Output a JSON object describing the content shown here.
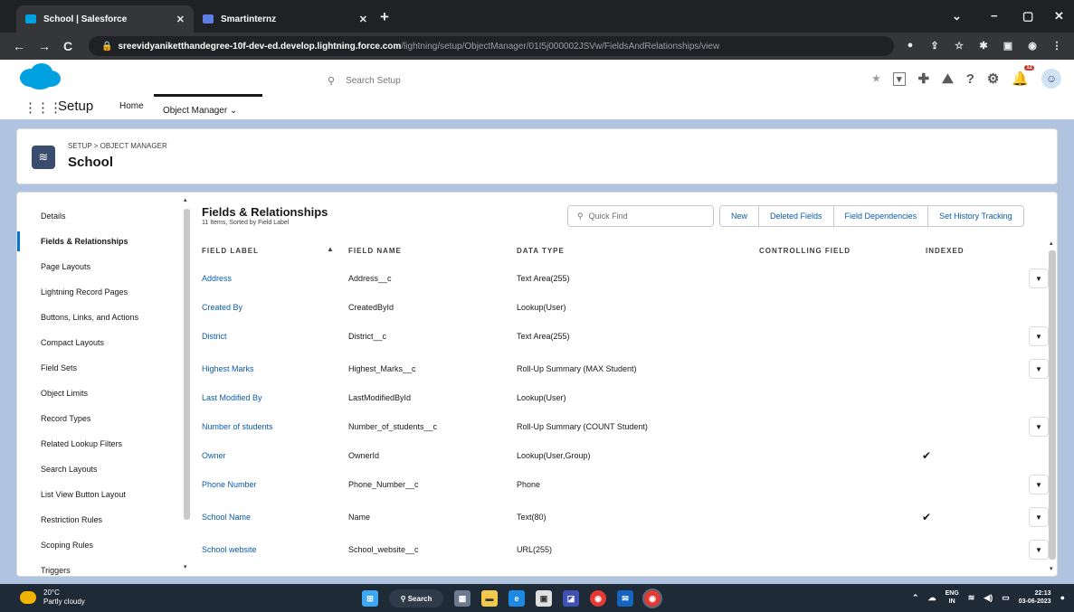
{
  "browser": {
    "tabs": [
      {
        "title": "School | Salesforce",
        "favicon_color": "#00a1e0"
      },
      {
        "title": "Smartinternz",
        "favicon_color": "#5e7ce2"
      }
    ],
    "url_host": "sreevidyaniketthandegree-10f-dev-ed.develop.lightning.force.com",
    "url_path": "/lightning/setup/ObjectManager/01I5j000002JSVw/FieldsAndRelationships/view"
  },
  "header": {
    "search_placeholder": "Search Setup",
    "app_name": "Setup",
    "nav_tabs": [
      "Home",
      "Object Manager"
    ],
    "notification_count": "12"
  },
  "object": {
    "breadcrumb": "SETUP > OBJECT MANAGER",
    "title": "School"
  },
  "sidebar": {
    "items": [
      "Details",
      "Fields & Relationships",
      "Page Layouts",
      "Lightning Record Pages",
      "Buttons, Links, and Actions",
      "Compact Layouts",
      "Field Sets",
      "Object Limits",
      "Record Types",
      "Related Lookup Filters",
      "Search Layouts",
      "List View Button Layout",
      "Restriction Rules",
      "Scoping Rules",
      "Triggers"
    ],
    "selected_index": 1
  },
  "fields": {
    "title": "Fields & Relationships",
    "subtitle": "11 Items, Sorted by Field Label",
    "quick_find_placeholder": "Quick Find",
    "buttons": [
      "New",
      "Deleted Fields",
      "Field Dependencies",
      "Set History Tracking"
    ],
    "columns": [
      "FIELD LABEL",
      "FIELD NAME",
      "DATA TYPE",
      "CONTROLLING FIELD",
      "INDEXED"
    ],
    "rows": [
      {
        "label": "Address",
        "name": "Address__c",
        "type": "Text Area(255)",
        "controlling": "",
        "indexed": false,
        "menu": true
      },
      {
        "label": "Created By",
        "name": "CreatedById",
        "type": "Lookup(User)",
        "controlling": "",
        "indexed": false,
        "menu": false
      },
      {
        "label": "District",
        "name": "District__c",
        "type": "Text Area(255)",
        "controlling": "",
        "indexed": false,
        "menu": true
      },
      {
        "label": "Highest Marks",
        "name": "Highest_Marks__c",
        "type": "Roll-Up Summary (MAX Student)",
        "controlling": "",
        "indexed": false,
        "menu": true
      },
      {
        "label": "Last Modified By",
        "name": "LastModifiedById",
        "type": "Lookup(User)",
        "controlling": "",
        "indexed": false,
        "menu": false
      },
      {
        "label": "Number of students",
        "name": "Number_of_students__c",
        "type": "Roll-Up Summary (COUNT Student)",
        "controlling": "",
        "indexed": false,
        "menu": true
      },
      {
        "label": "Owner",
        "name": "OwnerId",
        "type": "Lookup(User,Group)",
        "controlling": "",
        "indexed": true,
        "menu": false
      },
      {
        "label": "Phone Number",
        "name": "Phone_Number__c",
        "type": "Phone",
        "controlling": "",
        "indexed": false,
        "menu": true
      },
      {
        "label": "School Name",
        "name": "Name",
        "type": "Text(80)",
        "controlling": "",
        "indexed": true,
        "menu": true
      },
      {
        "label": "School website",
        "name": "School_website__c",
        "type": "URL(255)",
        "controlling": "",
        "indexed": false,
        "menu": true
      }
    ]
  },
  "taskbar": {
    "temperature": "20°C",
    "weather": "Partly cloudy",
    "search_label": "Search",
    "lang": "ENG",
    "region": "IN",
    "time": "22:13",
    "date": "03-06-2023"
  },
  "colors": {
    "brand": "#00a1e0",
    "link": "#0b5cab",
    "page_band": "#b0c4df",
    "taskbar": "#1f2a37"
  }
}
